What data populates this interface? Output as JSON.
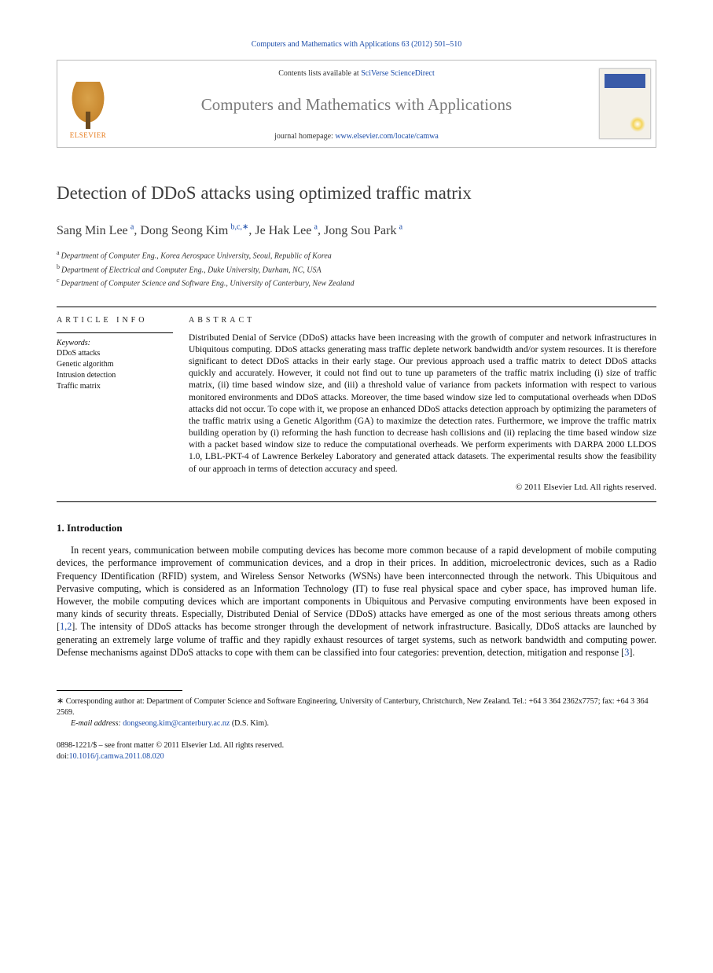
{
  "citation": "Computers and Mathematics with Applications 63 (2012) 501–510",
  "header": {
    "contents_prefix": "Contents lists available at ",
    "contents_link": "SciVerse ScienceDirect",
    "journal": "Computers and Mathematics with Applications",
    "homepage_prefix": "journal homepage: ",
    "homepage_link": "www.elsevier.com/locate/camwa",
    "publisher": "ELSEVIER"
  },
  "title": "Detection of DDoS attacks using optimized traffic matrix",
  "authors_html": "Sang Min Lee|a|, Dong Seong Kim|b,c,*|, Je Hak Lee|a|, Jong Sou Park|a",
  "authors": [
    {
      "name": "Sang Min Lee",
      "aff": "a"
    },
    {
      "name": "Dong Seong Kim",
      "aff": "b,c,",
      "corr": "∗"
    },
    {
      "name": "Je Hak Lee",
      "aff": "a"
    },
    {
      "name": "Jong Sou Park",
      "aff": "a"
    }
  ],
  "affiliations": [
    {
      "key": "a",
      "text": "Department of Computer Eng., Korea Aerospace University, Seoul, Republic of Korea"
    },
    {
      "key": "b",
      "text": "Department of Electrical and Computer Eng., Duke University, Durham, NC, USA"
    },
    {
      "key": "c",
      "text": "Department of Computer Science and Software Eng., University of Canterbury, New Zealand"
    }
  ],
  "article_info_head": "ARTICLE INFO",
  "keywords_label": "Keywords:",
  "keywords": [
    "DDoS attacks",
    "Genetic algorithm",
    "Intrusion detection",
    "Traffic matrix"
  ],
  "abstract_head": "ABSTRACT",
  "abstract": "Distributed Denial of Service (DDoS) attacks have been increasing with the growth of computer and network infrastructures in Ubiquitous computing. DDoS attacks generating mass traffic deplete network bandwidth and/or system resources. It is therefore significant to detect DDoS attacks in their early stage. Our previous approach used a traffic matrix to detect DDoS attacks quickly and accurately. However, it could not find out to tune up parameters of the traffic matrix including (i) size of traffic matrix, (ii) time based window size, and (iii) a threshold value of variance from packets information with respect to various monitored environments and DDoS attacks. Moreover, the time based window size led to computational overheads when DDoS attacks did not occur. To cope with it, we propose an enhanced DDoS attacks detection approach by optimizing the parameters of the traffic matrix using a Genetic Algorithm (GA) to maximize the detection rates. Furthermore, we improve the traffic matrix building operation by (i) reforming the hash function to decrease hash collisions and (ii) replacing the time based window size with a packet based window size to reduce the computational overheads. We perform experiments with DARPA 2000 LLDOS 1.0, LBL-PKT-4 of Lawrence Berkeley Laboratory and generated attack datasets. The experimental results show the feasibility of our approach in terms of detection accuracy and speed.",
  "copyright": "© 2011 Elsevier Ltd. All rights reserved.",
  "section1_head": "1. Introduction",
  "intro": "In recent years, communication between mobile computing devices has become more common because of a rapid development of mobile computing devices, the performance improvement of communication devices, and a drop in their prices. In addition, microelectronic devices, such as a Radio Frequency IDentification (RFID) system, and Wireless Sensor Networks (WSNs) have been interconnected through the network. This Ubiquitous and Pervasive computing, which is considered as an Information Technology (IT) to fuse real physical space and cyber space, has improved human life. However, the mobile computing devices which are important components in Ubiquitous and Pervasive computing environments have been exposed in many kinds of security threats. Especially, Distributed Denial of Service (DDoS) attacks have emerged as one of the most serious threats among others [1,2]. The intensity of DDoS attacks has become stronger through the development of network infrastructure. Basically, DDoS attacks are launched by generating an extremely large volume of traffic and they rapidly exhaust resources of target systems, such as network bandwidth and computing power. Defense mechanisms against DDoS attacks to cope with them can be classified into four categories: prevention, detection, mitigation and response [3].",
  "footnote": {
    "corr_text": "Corresponding author at: Department of Computer Science and Software Engineering, University of Canterbury, Christchurch, New Zealand. Tel.: +64 3 364 2362x7757; fax: +64 3 364 2569.",
    "email_label": "E-mail address:",
    "email": "dongseong.kim@canterbury.ac.nz",
    "email_suffix": "(D.S. Kim)."
  },
  "bottom": {
    "issn_line": "0898-1221/$ – see front matter © 2011 Elsevier Ltd. All rights reserved.",
    "doi_label": "doi:",
    "doi": "10.1016/j.camwa.2011.08.020"
  }
}
